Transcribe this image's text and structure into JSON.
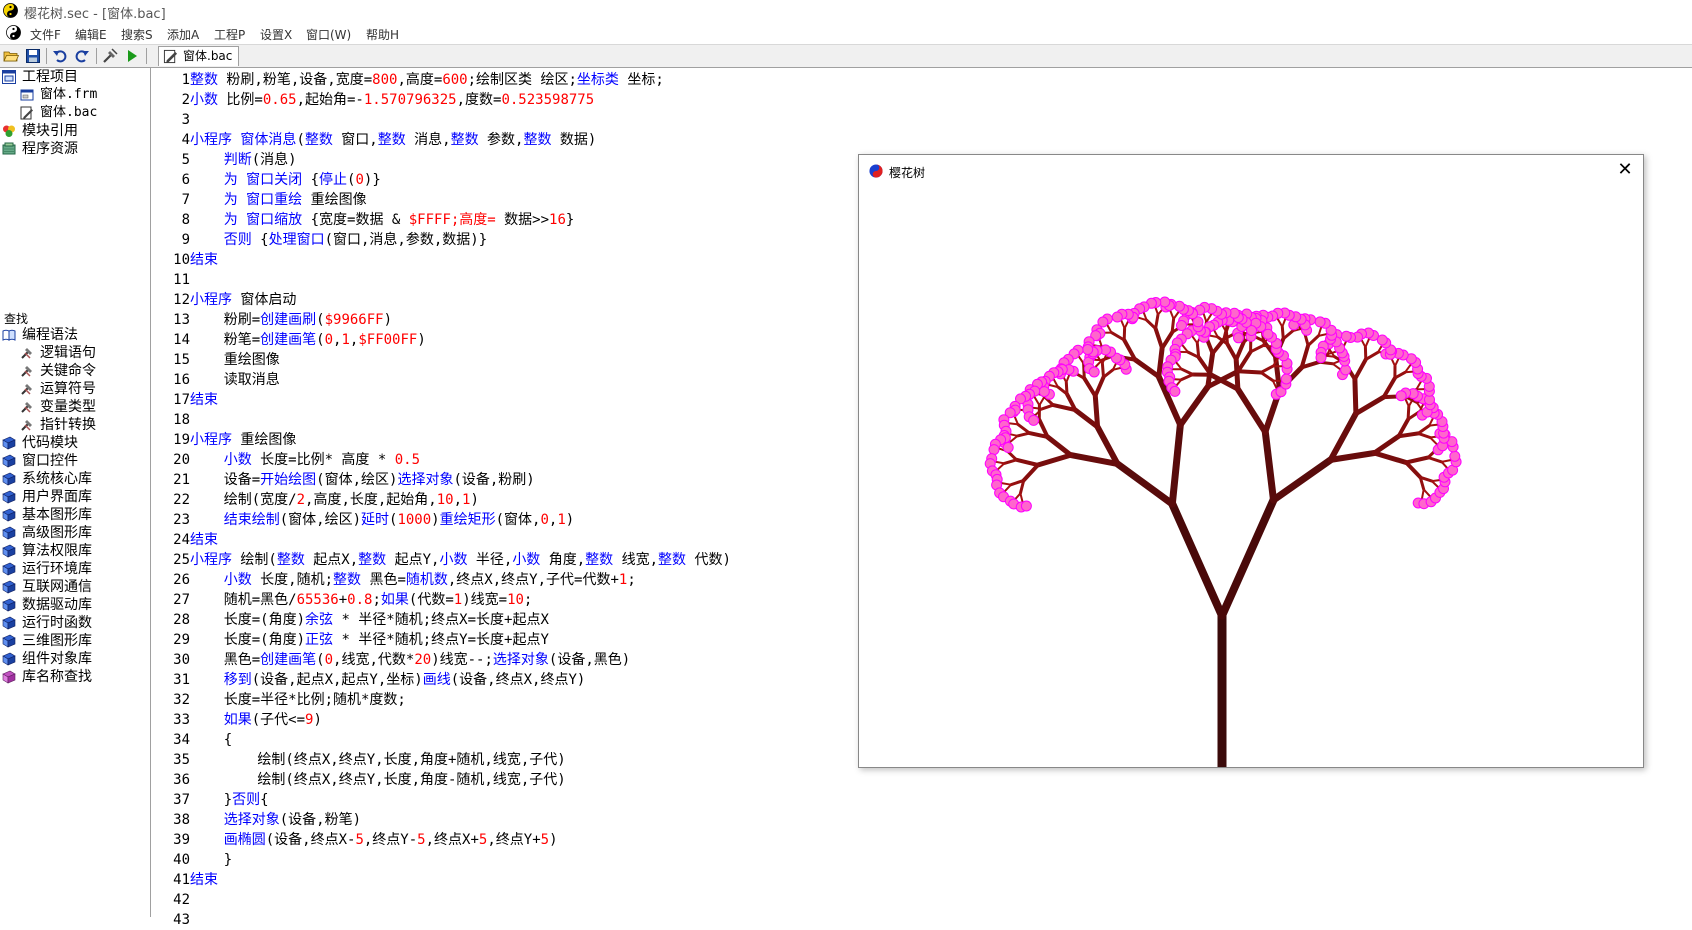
{
  "window": {
    "title": "樱花树.sec - [窗体.bac]"
  },
  "menu": {
    "items": [
      "文件F",
      "编辑E",
      "搜索S",
      "添加A",
      "工程P",
      "设置X",
      "窗口(W)",
      "帮助H"
    ]
  },
  "toolbar": {
    "icons": [
      "open-folder-icon",
      "save-icon",
      "undo-icon",
      "redo-icon",
      "build-icon",
      "run-icon"
    ],
    "tab": {
      "label": "窗体.bac"
    }
  },
  "sidebar": {
    "project": {
      "root": "工程项目",
      "files": [
        "窗体.frm",
        "窗体.bac"
      ],
      "others": [
        "模块引用",
        "程序资源"
      ]
    },
    "find_label": "查找",
    "syntax": {
      "root": "编程语法",
      "children": [
        "逻辑语句",
        "关键命令",
        "运算符号",
        "变量类型",
        "指针转换"
      ]
    },
    "libraries": [
      "代码模块",
      "窗口控件",
      "系统核心库",
      "用户界面库",
      "基本图形库",
      "高级图形库",
      "算法权限库",
      "运行环境库",
      "互联网通信",
      "数据驱动库",
      "运行时函数",
      "三维图形库",
      "组件对象库",
      "库名称查找"
    ]
  },
  "code": {
    "lines": [
      [
        [
          "k",
          "整数"
        ],
        [
          "t",
          " 粉刷,粉笔,设备,宽度="
        ],
        [
          "n",
          "800"
        ],
        [
          "t",
          ",高度="
        ],
        [
          "n",
          "600"
        ],
        [
          "t",
          ";绘制区类 绘区;"
        ],
        [
          "k",
          "坐标类"
        ],
        [
          "t",
          " 坐标;"
        ]
      ],
      [
        [
          "k",
          "小数"
        ],
        [
          "t",
          " 比例="
        ],
        [
          "n",
          "0.65"
        ],
        [
          "t",
          ",起始角=-"
        ],
        [
          "n",
          "1.570796325"
        ],
        [
          "t",
          ",度数="
        ],
        [
          "n",
          "0.523598775"
        ]
      ],
      [],
      [
        [
          "k",
          "小程序 窗体消息"
        ],
        [
          "t",
          "("
        ],
        [
          "k",
          "整数"
        ],
        [
          "t",
          " 窗口,"
        ],
        [
          "k",
          "整数"
        ],
        [
          "t",
          " 消息,"
        ],
        [
          "k",
          "整数"
        ],
        [
          "t",
          " 参数,"
        ],
        [
          "k",
          "整数"
        ],
        [
          "t",
          " 数据)"
        ]
      ],
      [
        [
          "t",
          "    "
        ],
        [
          "k",
          "判断"
        ],
        [
          "t",
          "(消息)"
        ]
      ],
      [
        [
          "t",
          "    "
        ],
        [
          "k",
          "为 窗口关闭"
        ],
        [
          "t",
          " {"
        ],
        [
          "k",
          "停止"
        ],
        [
          "t",
          "("
        ],
        [
          "n",
          "0"
        ],
        [
          "t",
          ")}"
        ]
      ],
      [
        [
          "t",
          "    "
        ],
        [
          "k",
          "为 窗口重绘"
        ],
        [
          "t",
          " 重绘图像"
        ]
      ],
      [
        [
          "t",
          "    "
        ],
        [
          "k",
          "为 窗口缩放"
        ],
        [
          "t",
          " {宽度=数据 & "
        ],
        [
          "n",
          "$FFFF;高度="
        ],
        [
          "t",
          " 数据>>"
        ],
        [
          "n",
          "16"
        ],
        [
          "t",
          "}"
        ]
      ],
      [
        [
          "t",
          "    "
        ],
        [
          "k",
          "否则"
        ],
        [
          "t",
          " {"
        ],
        [
          "k",
          "处理窗口"
        ],
        [
          "t",
          "(窗口,消息,参数,数据)}"
        ]
      ],
      [
        [
          "k",
          "结束"
        ]
      ],
      [],
      [
        [
          "k",
          "小程序"
        ],
        [
          "t",
          " 窗体启动"
        ]
      ],
      [
        [
          "t",
          "    粉刷="
        ],
        [
          "k",
          "创建画刷"
        ],
        [
          "t",
          "("
        ],
        [
          "n",
          "$9966FF"
        ],
        [
          "t",
          ")"
        ]
      ],
      [
        [
          "t",
          "    粉笔="
        ],
        [
          "k",
          "创建画笔"
        ],
        [
          "t",
          "("
        ],
        [
          "n",
          "0"
        ],
        [
          "t",
          ","
        ],
        [
          "n",
          "1"
        ],
        [
          "t",
          ","
        ],
        [
          "n",
          "$FF00FF"
        ],
        [
          "t",
          ")"
        ]
      ],
      [
        [
          "t",
          "    重绘图像"
        ]
      ],
      [
        [
          "t",
          "    读取消息"
        ]
      ],
      [
        [
          "k",
          "结束"
        ]
      ],
      [],
      [
        [
          "k",
          "小程序"
        ],
        [
          "t",
          " 重绘图像"
        ]
      ],
      [
        [
          "t",
          "    "
        ],
        [
          "k",
          "小数"
        ],
        [
          "t",
          " 长度=比例* 高度 * "
        ],
        [
          "n",
          "0.5"
        ]
      ],
      [
        [
          "t",
          "    设备="
        ],
        [
          "k",
          "开始绘图"
        ],
        [
          "t",
          "(窗体,绘区)"
        ],
        [
          "k",
          "选择对象"
        ],
        [
          "t",
          "(设备,粉刷)"
        ]
      ],
      [
        [
          "t",
          "    绘制(宽度/"
        ],
        [
          "n",
          "2"
        ],
        [
          "t",
          ",高度,长度,起始角,"
        ],
        [
          "n",
          "10"
        ],
        [
          "t",
          ","
        ],
        [
          "n",
          "1"
        ],
        [
          "t",
          ")"
        ]
      ],
      [
        [
          "t",
          "    "
        ],
        [
          "k",
          "结束绘制"
        ],
        [
          "t",
          "(窗体,绘区)"
        ],
        [
          "k",
          "延时"
        ],
        [
          "t",
          "("
        ],
        [
          "n",
          "1000"
        ],
        [
          "t",
          ")"
        ],
        [
          "k",
          "重绘矩形"
        ],
        [
          "t",
          "(窗体,"
        ],
        [
          "n",
          "0"
        ],
        [
          "t",
          ","
        ],
        [
          "n",
          "1"
        ],
        [
          "t",
          ")"
        ]
      ],
      [
        [
          "k",
          "结束"
        ]
      ],
      [
        [
          "k",
          "小程序"
        ],
        [
          "t",
          " 绘制("
        ],
        [
          "k",
          "整数"
        ],
        [
          "t",
          " 起点X,"
        ],
        [
          "k",
          "整数"
        ],
        [
          "t",
          " 起点Y,"
        ],
        [
          "k",
          "小数"
        ],
        [
          "t",
          " 半径,"
        ],
        [
          "k",
          "小数"
        ],
        [
          "t",
          " 角度,"
        ],
        [
          "k",
          "整数"
        ],
        [
          "t",
          " 线宽,"
        ],
        [
          "k",
          "整数"
        ],
        [
          "t",
          " 代数)"
        ]
      ],
      [
        [
          "t",
          "    "
        ],
        [
          "k",
          "小数"
        ],
        [
          "t",
          " 长度,随机;"
        ],
        [
          "k",
          "整数"
        ],
        [
          "t",
          " 黑色="
        ],
        [
          "k",
          "随机数"
        ],
        [
          "t",
          ",终点X,终点Y,子代=代数+"
        ],
        [
          "n",
          "1"
        ],
        [
          "t",
          ";"
        ]
      ],
      [
        [
          "t",
          "    随机=黑色/"
        ],
        [
          "n",
          "65536"
        ],
        [
          "t",
          "+"
        ],
        [
          "n",
          "0.8"
        ],
        [
          "t",
          ";"
        ],
        [
          "k",
          "如果"
        ],
        [
          "t",
          "(代数="
        ],
        [
          "n",
          "1"
        ],
        [
          "t",
          ")线宽="
        ],
        [
          "n",
          "10"
        ],
        [
          "t",
          ";"
        ]
      ],
      [
        [
          "t",
          "    长度=(角度)"
        ],
        [
          "k",
          "余弦"
        ],
        [
          "t",
          " * 半径*随机;终点X=长度+起点X"
        ]
      ],
      [
        [
          "t",
          "    长度=(角度)"
        ],
        [
          "k",
          "正弦"
        ],
        [
          "t",
          " * 半径*随机;终点Y=长度+起点Y"
        ]
      ],
      [
        [
          "t",
          "    黑色="
        ],
        [
          "k",
          "创建画笔"
        ],
        [
          "t",
          "("
        ],
        [
          "n",
          "0"
        ],
        [
          "t",
          ",线宽,代数*"
        ],
        [
          "n",
          "20"
        ],
        [
          "t",
          ")线宽--;"
        ],
        [
          "k",
          "选择对象"
        ],
        [
          "t",
          "(设备,黑色)"
        ]
      ],
      [
        [
          "t",
          "    "
        ],
        [
          "k",
          "移到"
        ],
        [
          "t",
          "(设备,起点X,起点Y,坐标)"
        ],
        [
          "k",
          "画线"
        ],
        [
          "t",
          "(设备,终点X,终点Y)"
        ]
      ],
      [
        [
          "t",
          "    长度=半径*比例;随机*度数;"
        ]
      ],
      [
        [
          "t",
          "    "
        ],
        [
          "k",
          "如果"
        ],
        [
          "t",
          "(子代<="
        ],
        [
          "n",
          "9"
        ],
        [
          "t",
          ")"
        ]
      ],
      [
        [
          "t",
          "    {"
        ]
      ],
      [
        [
          "t",
          "        绘制(终点X,终点Y,长度,角度+随机,线宽,子代)"
        ]
      ],
      [
        [
          "t",
          "        绘制(终点X,终点Y,长度,角度-随机,线宽,子代)"
        ]
      ],
      [
        [
          "t",
          "    }"
        ],
        [
          "k",
          "否则"
        ],
        [
          "t",
          "{"
        ]
      ],
      [
        [
          "t",
          "    "
        ],
        [
          "k",
          "选择对象"
        ],
        [
          "t",
          "(设备,粉笔)"
        ]
      ],
      [
        [
          "t",
          "    "
        ],
        [
          "k",
          "画椭圆"
        ],
        [
          "t",
          "(设备,终点X-"
        ],
        [
          "n",
          "5"
        ],
        [
          "t",
          ",终点Y-"
        ],
        [
          "n",
          "5"
        ],
        [
          "t",
          ",终点X+"
        ],
        [
          "n",
          "5"
        ],
        [
          "t",
          ",终点Y+"
        ],
        [
          "n",
          "5"
        ],
        [
          "t",
          ")"
        ]
      ],
      [
        [
          "t",
          "    }"
        ]
      ],
      [
        [
          "k",
          "结束"
        ]
      ],
      [],
      []
    ]
  },
  "popup": {
    "title": "樱花树",
    "close_glyph": "✕",
    "colors": {
      "trunk": "#3a0a0a",
      "branch": "#8b1a1a",
      "blossom": "#ff66cc",
      "blossom_edge": "#ff00ff"
    }
  }
}
